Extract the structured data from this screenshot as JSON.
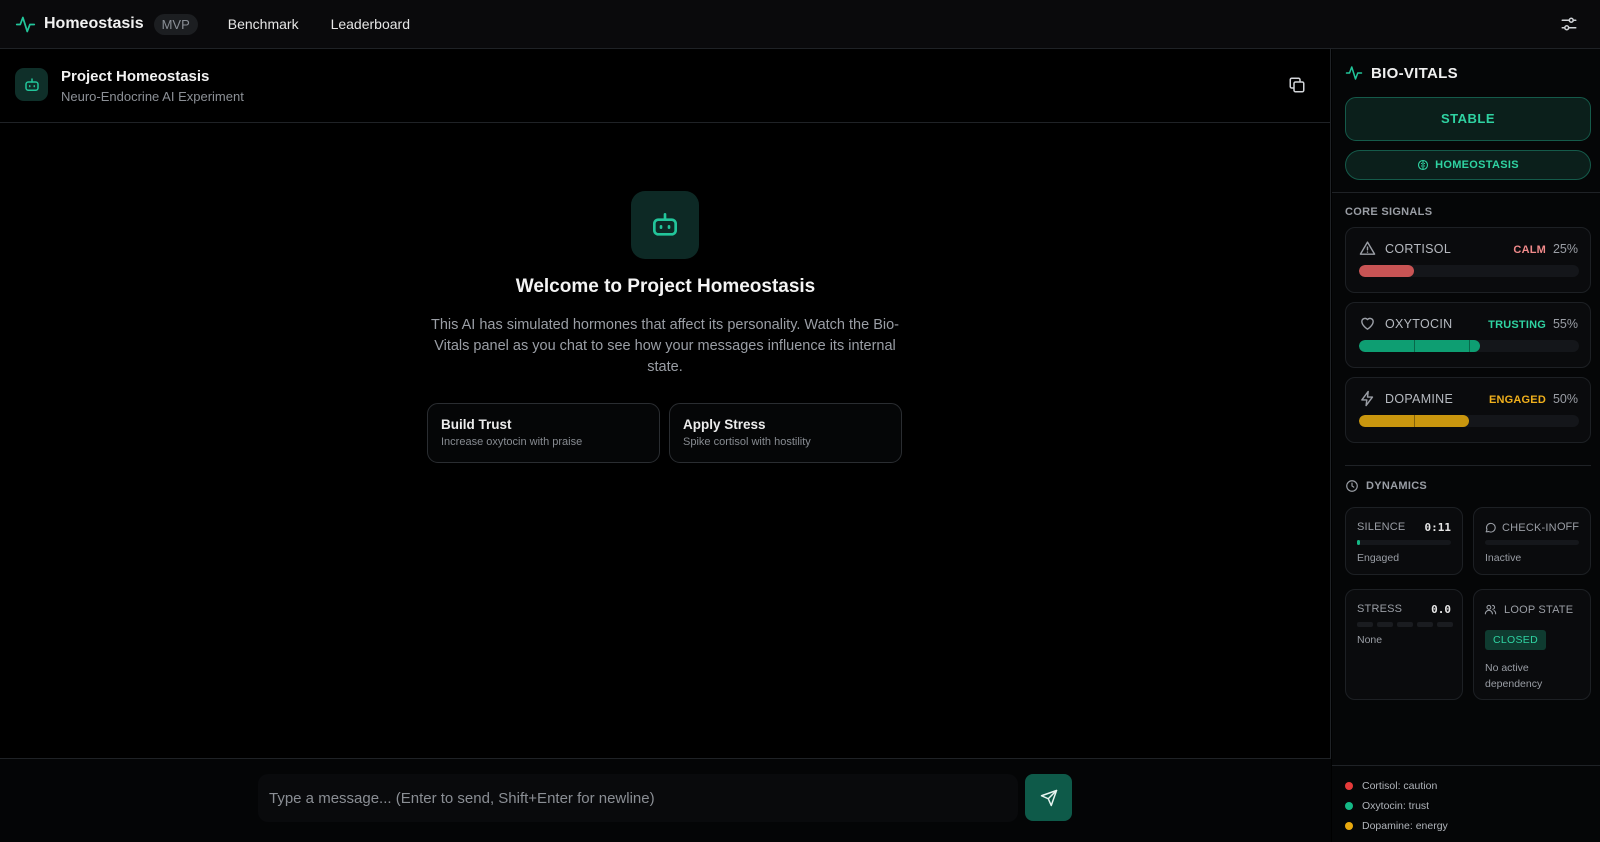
{
  "topbar": {
    "brand": "Homeostasis",
    "badge": "MVP",
    "nav": [
      "Benchmark",
      "Leaderboard"
    ],
    "icons": {
      "logo": "pulse-icon",
      "settings": "sliders-icon"
    }
  },
  "project": {
    "title": "Project Homeostasis",
    "subtitle": "Neuro-Endocrine AI Experiment"
  },
  "welcome": {
    "title": "Welcome to Project Homeostasis",
    "text": "This AI has simulated hormones that affect its personality. Watch the Bio-Vitals panel as you chat to see how your messages influence its internal state.",
    "actions": [
      {
        "title": "Build Trust",
        "desc": "Increase oxytocin with praise"
      },
      {
        "title": "Apply Stress",
        "desc": "Spike cortisol with hostility"
      }
    ]
  },
  "composer": {
    "placeholder": "Type a message... (Enter to send, Shift+Enter for newline)"
  },
  "panel": {
    "title": "BIO-VITALS",
    "status": "STABLE",
    "mode": "HOMEOSTASIS",
    "core_label": "CORE SIGNALS",
    "signals": [
      {
        "name": "CORTISOL",
        "state": "CALM",
        "pct": "25%",
        "level": 0.25,
        "color": "#c85454",
        "state_color": "#f08a8a",
        "icon": "warning-triangle-icon"
      },
      {
        "name": "OXYTOCIN",
        "state": "TRUSTING",
        "pct": "55%",
        "level": 0.55,
        "color": "#0e9e72",
        "state_color": "#2fd3a2",
        "icon": "heart-icon"
      },
      {
        "name": "DOPAMINE",
        "state": "ENGAGED",
        "pct": "50%",
        "level": 0.5,
        "color": "#c9960e",
        "state_color": "#f0b01c",
        "icon": "lightning-icon"
      }
    ],
    "dynamics_label": "DYNAMICS",
    "dynamics": {
      "silence": {
        "label": "SILENCE",
        "value": "0:11",
        "sub": "Engaged",
        "level": 0.03
      },
      "checkin": {
        "label": "CHECK-IN",
        "value": "OFF",
        "sub": "Inactive"
      },
      "stress": {
        "label": "STRESS",
        "value": "0.0",
        "sub": "None"
      },
      "loop": {
        "label": "LOOP STATE",
        "badge": "CLOSED",
        "sub": "No active dependency"
      }
    },
    "legend": [
      {
        "label": "Cortisol: caution",
        "color": "#e53a3a"
      },
      {
        "label": "Oxytocin: trust",
        "color": "#14b885"
      },
      {
        "label": "Dopamine: energy",
        "color": "#e9a90e"
      }
    ]
  }
}
